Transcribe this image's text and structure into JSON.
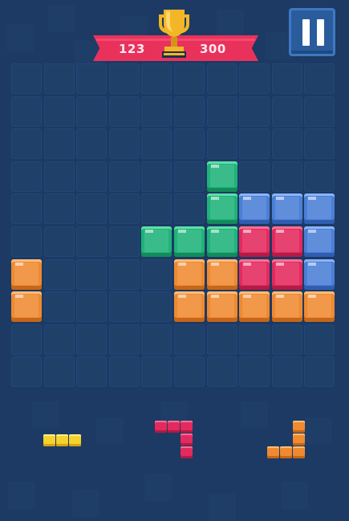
{
  "score": {
    "current": "123",
    "best": "300"
  },
  "colors": {
    "background": "#1c3a63",
    "empty_cell": "#1f4169",
    "green": "#1fb37a",
    "blue": "#4a7fd6",
    "red": "#e32a5e",
    "orange": "#ef8a31",
    "yellow": "#f5d22d",
    "banner": "#e8325c",
    "trophy": "#f2b626"
  },
  "icons": {
    "trophy": "trophy-icon",
    "pause": "pause-icon"
  },
  "board": {
    "rows": 10,
    "cols": 10,
    "filled": [
      {
        "row": 3,
        "col": 6,
        "color": "green"
      },
      {
        "row": 4,
        "col": 6,
        "color": "green"
      },
      {
        "row": 4,
        "col": 7,
        "color": "blue"
      },
      {
        "row": 4,
        "col": 8,
        "color": "blue"
      },
      {
        "row": 4,
        "col": 9,
        "color": "blue"
      },
      {
        "row": 5,
        "col": 4,
        "color": "green"
      },
      {
        "row": 5,
        "col": 5,
        "color": "green"
      },
      {
        "row": 5,
        "col": 6,
        "color": "green"
      },
      {
        "row": 5,
        "col": 7,
        "color": "red"
      },
      {
        "row": 5,
        "col": 8,
        "color": "red"
      },
      {
        "row": 5,
        "col": 9,
        "color": "blue"
      },
      {
        "row": 6,
        "col": 0,
        "color": "orange"
      },
      {
        "row": 6,
        "col": 5,
        "color": "orange"
      },
      {
        "row": 6,
        "col": 6,
        "color": "orange"
      },
      {
        "row": 6,
        "col": 7,
        "color": "red"
      },
      {
        "row": 6,
        "col": 8,
        "color": "red"
      },
      {
        "row": 6,
        "col": 9,
        "color": "blue"
      },
      {
        "row": 7,
        "col": 0,
        "color": "orange"
      },
      {
        "row": 7,
        "col": 5,
        "color": "orange"
      },
      {
        "row": 7,
        "col": 6,
        "color": "orange"
      },
      {
        "row": 7,
        "col": 7,
        "color": "orange"
      },
      {
        "row": 7,
        "col": 8,
        "color": "orange"
      },
      {
        "row": 7,
        "col": 9,
        "color": "orange"
      }
    ]
  },
  "pieces": [
    {
      "name": "piece-yellow-line",
      "color": "yellow",
      "cells": [
        [
          0,
          0
        ],
        [
          0,
          1
        ],
        [
          0,
          2
        ]
      ]
    },
    {
      "name": "piece-red-corner",
      "color": "red",
      "cells": [
        [
          0,
          0
        ],
        [
          0,
          1
        ],
        [
          0,
          2
        ],
        [
          1,
          2
        ],
        [
          2,
          2
        ]
      ]
    },
    {
      "name": "piece-orange-corner",
      "color": "orange",
      "cells": [
        [
          0,
          2
        ],
        [
          1,
          2
        ],
        [
          2,
          0
        ],
        [
          2,
          1
        ],
        [
          2,
          2
        ]
      ]
    }
  ]
}
